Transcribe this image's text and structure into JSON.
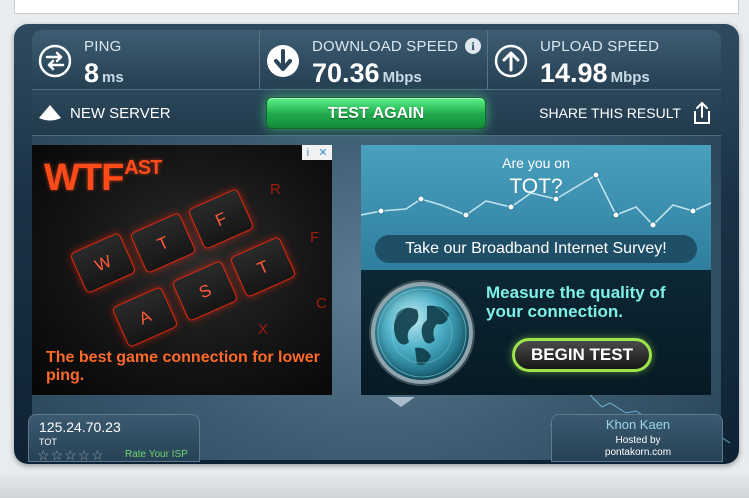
{
  "stats": {
    "ping": {
      "title": "PING",
      "value": "8",
      "unit": "ms"
    },
    "download": {
      "title": "DOWNLOAD SPEED",
      "value": "70.36",
      "unit": "Mbps",
      "info": "i"
    },
    "upload": {
      "title": "UPLOAD SPEED",
      "value": "14.98",
      "unit": "Mbps"
    }
  },
  "actions": {
    "new_server": "NEW SERVER",
    "test_again": "TEST AGAIN",
    "share": "SHARE THIS RESULT"
  },
  "ad_left": {
    "logo": "WTF",
    "logo_suffix": "AST",
    "tagline": "The best game connection for lower ping.",
    "keys": [
      "W",
      "T",
      "F",
      "A",
      "S",
      "T"
    ],
    "close_i": "i",
    "close_x": "✕"
  },
  "ad_right": {
    "question_line1": "Are you on",
    "question_line2": "TOT?",
    "survey_button": "Take our Broadband Internet Survey!",
    "measure_text": "Measure the quality of your connection.",
    "begin_button": "BEGIN TEST"
  },
  "footer": {
    "ip": "125.24.70.23",
    "isp": "TOT",
    "rating_stars": "☆☆☆☆☆",
    "rate_label": "Rate Your ISP",
    "city": "Khon Kaen",
    "hosted_by": "Hosted by",
    "host": "pontakorn.com"
  },
  "colors": {
    "accent_green": "#1fa94c",
    "panel_dark": "#223a4c",
    "wtf_orange": "#ff4a1a",
    "begin_border": "#9ee34a"
  }
}
